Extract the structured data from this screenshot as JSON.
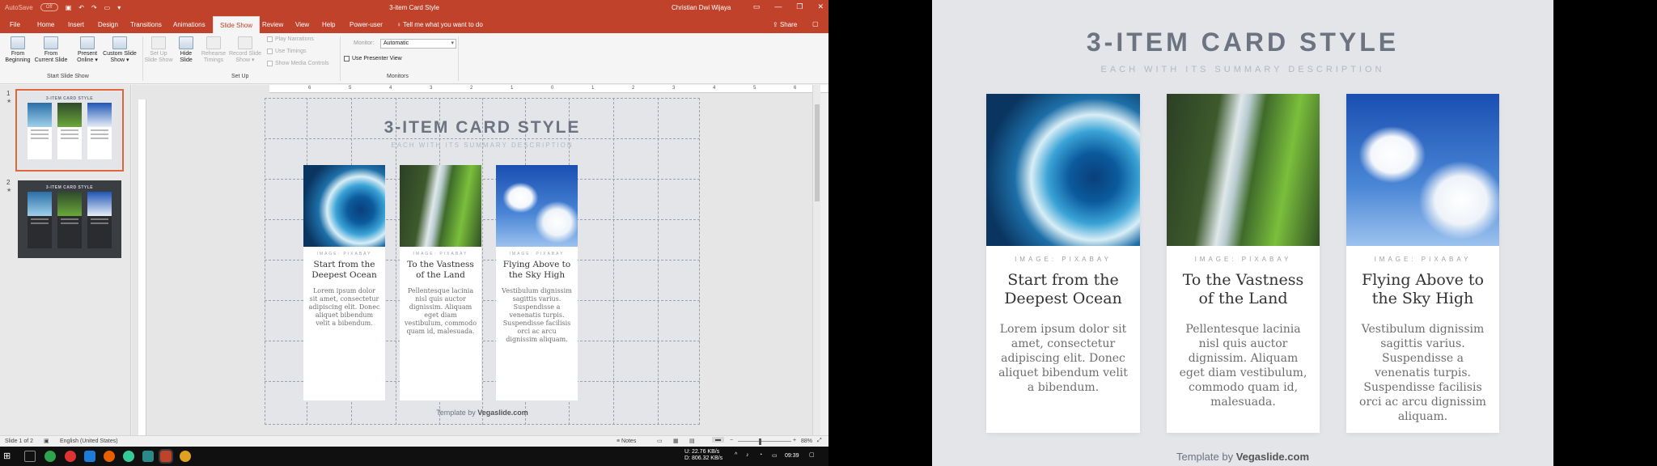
{
  "app": {
    "autosave_label": "AutoSave",
    "autosave_state": "Off",
    "window_title": "3-item Card Style",
    "user_name": "Christian Dwi Wijaya",
    "tabs": [
      "File",
      "Home",
      "Insert",
      "Design",
      "Transitions",
      "Animations",
      "Slide Show",
      "Review",
      "View",
      "Help",
      "Power-user"
    ],
    "active_tab": "Slide Show",
    "tell_me": "Tell me what you want to do",
    "share": "Share"
  },
  "ribbon": {
    "buttons": [
      {
        "label": "From\nBeginning",
        "enabled": true
      },
      {
        "label": "From\nCurrent Slide",
        "enabled": true
      },
      {
        "label": "Present\nOnline ▾",
        "enabled": true
      },
      {
        "label": "Custom Slide\nShow ▾",
        "enabled": true
      },
      {
        "label": "Set Up\nSlide Show",
        "enabled": false
      },
      {
        "label": "Hide\nSlide",
        "enabled": true
      },
      {
        "label": "Rehearse\nTimings",
        "enabled": false
      },
      {
        "label": "Record Slide\nShow ▾",
        "enabled": false
      }
    ],
    "checks": [
      "Play Narrations",
      "Use Timings",
      "Show Media Controls"
    ],
    "groups": [
      "Start Slide Show",
      "Set Up",
      "Monitors"
    ],
    "monitor_label": "Monitor:",
    "monitor_value": "Automatic",
    "presenter_view": "Use Presenter View"
  },
  "ruler": [
    "6",
    "5",
    "4",
    "3",
    "2",
    "1",
    "0",
    "1",
    "2",
    "3",
    "4",
    "5",
    "6"
  ],
  "status": {
    "slide_info": "Slide 1 of 2",
    "language": "English (United States)",
    "notes": "Notes",
    "zoom": "88%"
  },
  "taskbar": {
    "net_up": "22.76 KB/s",
    "net_down": "806.32 KB/s",
    "net_up_label": "U:",
    "net_down_label": "D:",
    "time": "09:39"
  },
  "slide": {
    "title": "3-ITEM CARD STYLE",
    "subtitle": "EACH WITH ITS SUMMARY DESCRIPTION",
    "credit": "IMAGE: PIXABAY",
    "footer_prefix": "Template by ",
    "footer_brand": "Vegaslide.com",
    "cards": [
      {
        "title": "Start from the Deepest Ocean",
        "body": "Lorem ipsum dolor sit amet, consectetur adipiscing elit. Donec aliquet bibendum velit a bibendum."
      },
      {
        "title": "To the Vastness of the Land",
        "body": "Pellentesque lacinia nisl quis auctor dignissim. Aliquam eget diam vestibulum, commodo quam id, malesuada."
      },
      {
        "title": "Flying Above to the Sky High",
        "body": "Vestibulum dignissim sagittis varius. Suspendisse a venenatis turpis. Suspendisse facilisis orci ac arcu dignissim aliquam."
      }
    ]
  },
  "thumbs": [
    {
      "num": "1"
    },
    {
      "num": "2"
    }
  ],
  "colors": {
    "accent": "#c0422b",
    "slide_bg": "#e3e5e8"
  }
}
